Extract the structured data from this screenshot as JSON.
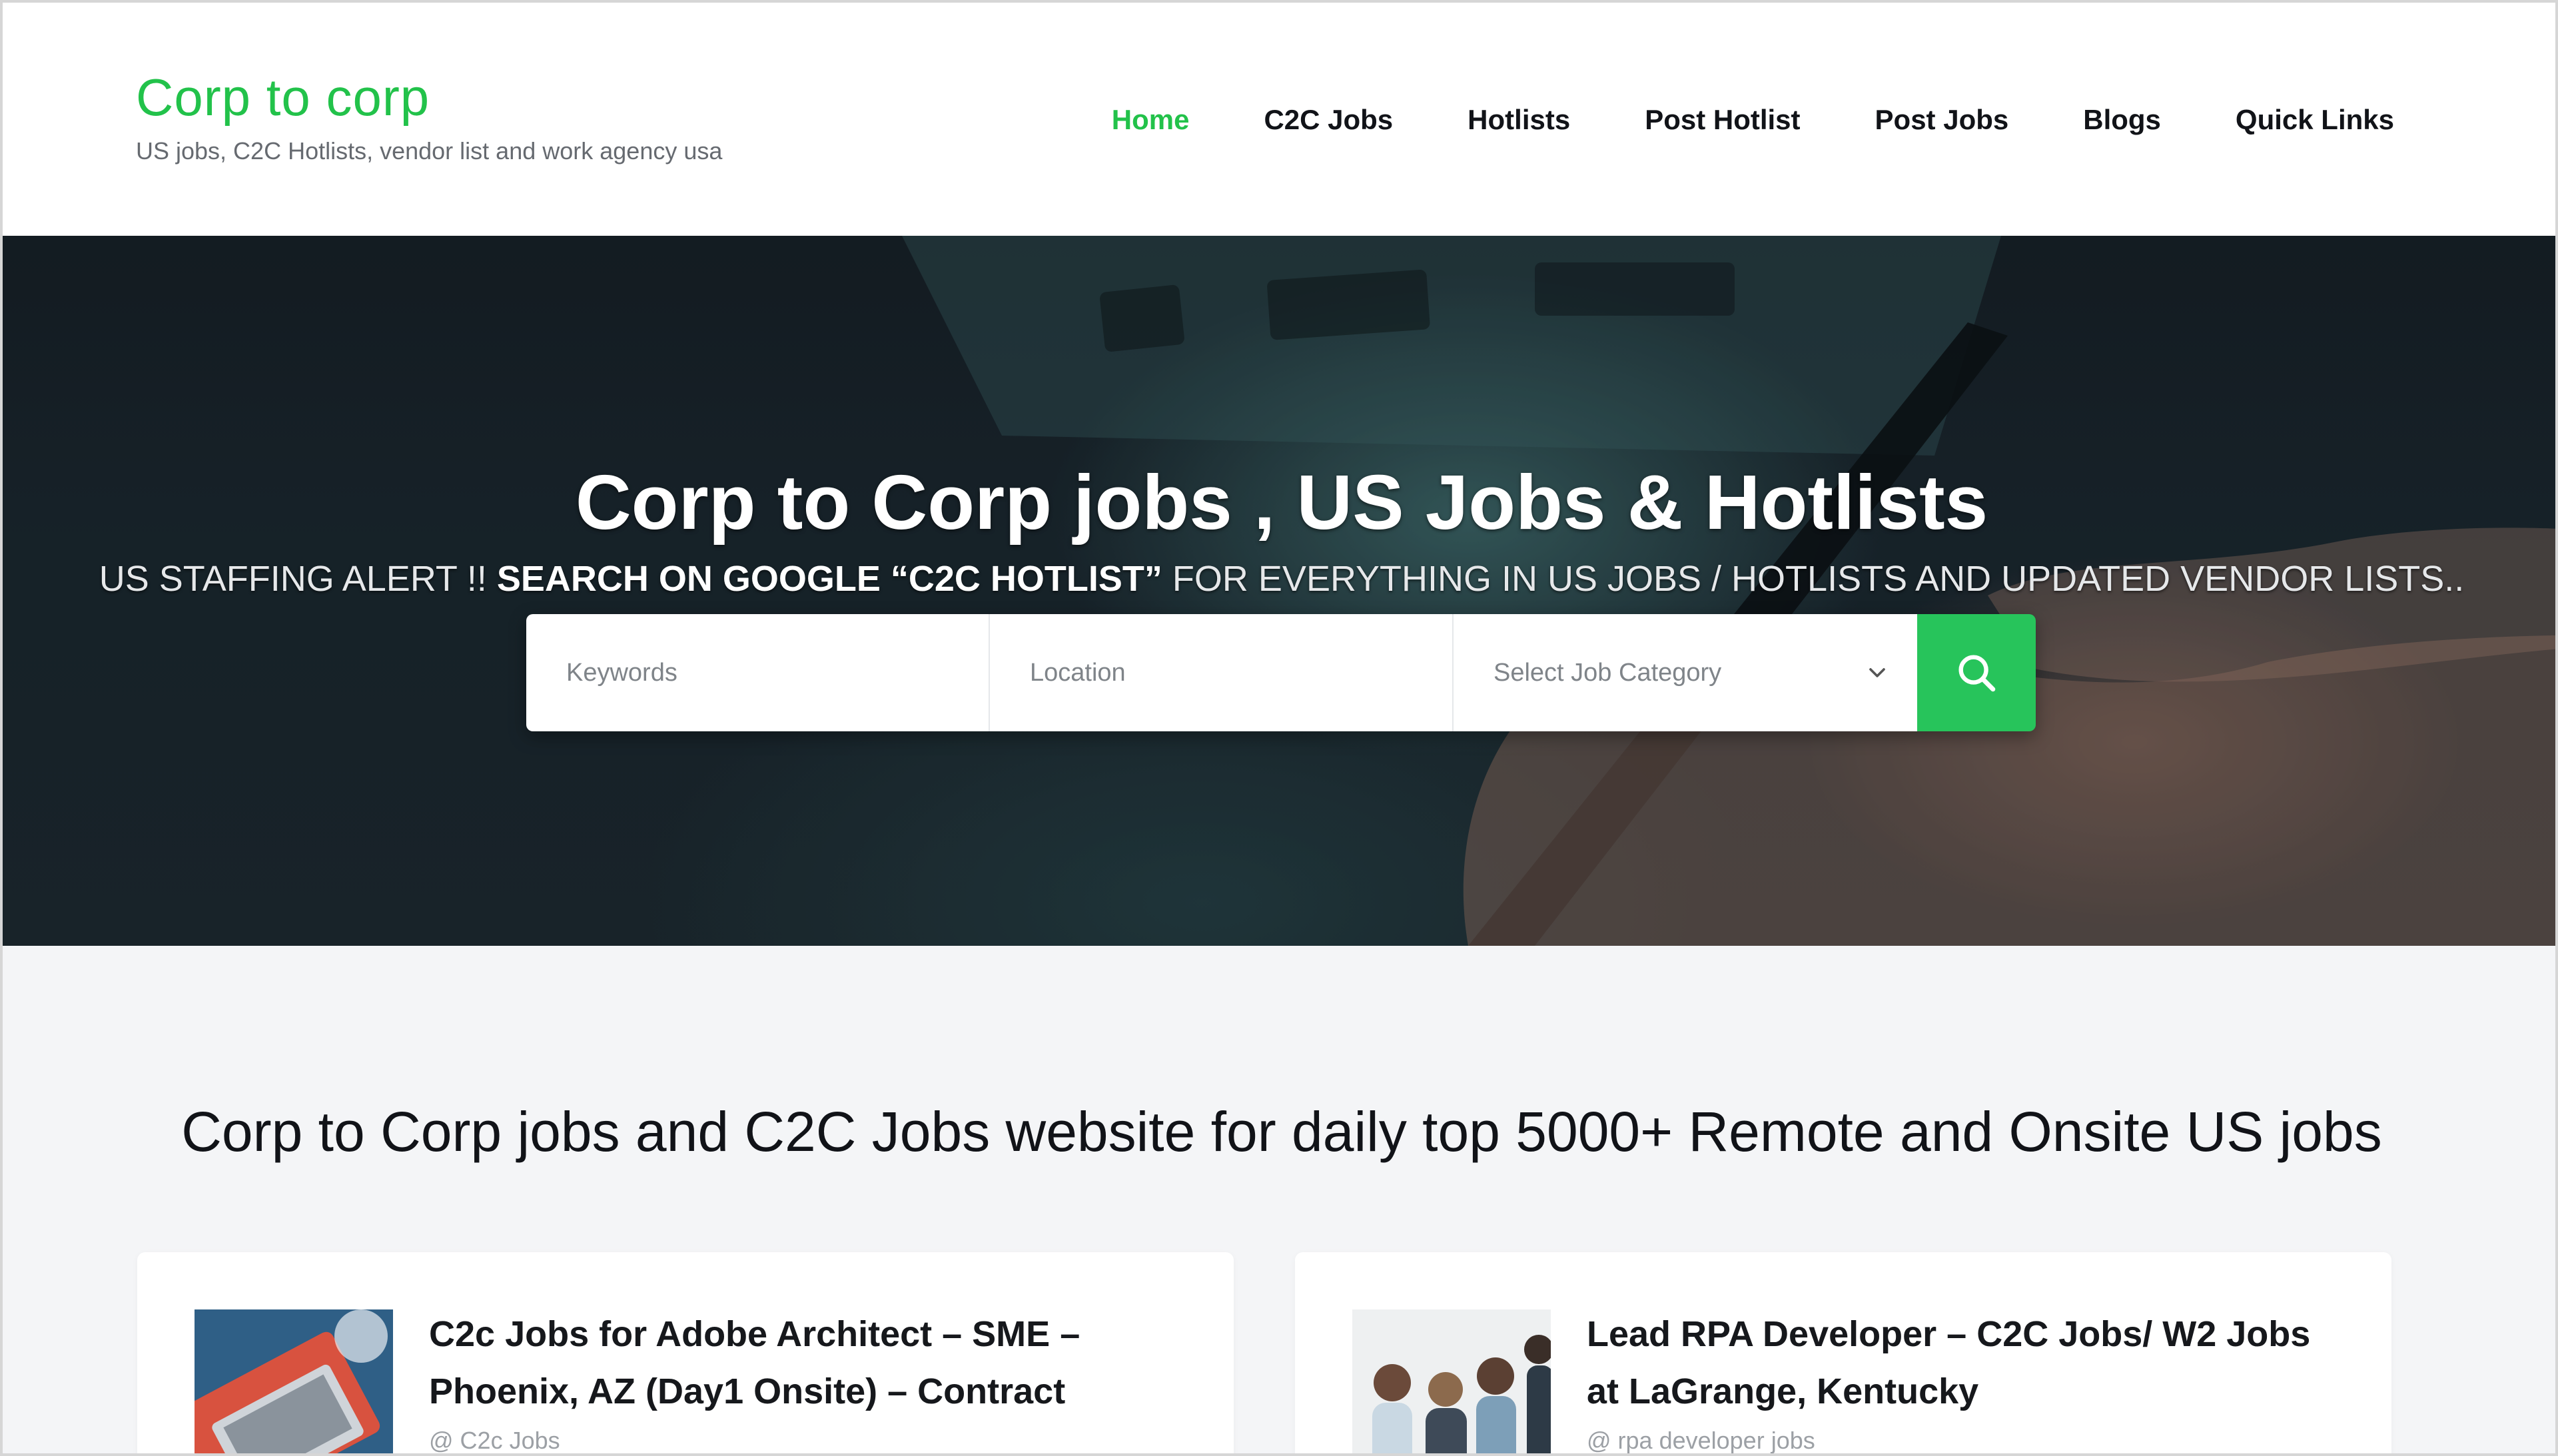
{
  "header": {
    "site_title": "Corp to corp",
    "tagline": "US jobs, C2C Hotlists, vendor list and work agency usa",
    "nav": [
      {
        "label": "Home",
        "active": true
      },
      {
        "label": "C2C Jobs"
      },
      {
        "label": "Hotlists"
      },
      {
        "label": "Post Hotlist"
      },
      {
        "label": "Post Jobs"
      },
      {
        "label": "Blogs"
      },
      {
        "label": "Quick Links"
      }
    ]
  },
  "hero": {
    "title": "Corp to Corp jobs , US Jobs & Hotlists",
    "alert_prefix": "US STAFFING ALERT !! ",
    "alert_bold": "SEARCH ON GOOGLE “C2C HOTLIST”",
    "alert_suffix": " FOR EVERYTHING IN US JOBS / HOTLISTS AND UPDATED VENDOR LISTS..",
    "search": {
      "keywords_placeholder": "Keywords",
      "location_placeholder": "Location",
      "category_value": "Select Job Category"
    }
  },
  "main": {
    "section_title": "Corp to Corp jobs and C2C Jobs website for daily top 5000+ Remote and Onsite US jobs",
    "cards": [
      {
        "title_line1": "C2c Jobs for Adobe Architect – SME –",
        "title_line2": "Phoenix, AZ (Day1 Onsite) – Contract",
        "meta": "@ C2c Jobs"
      },
      {
        "title_line1": "Lead RPA Developer – C2C Jobs/ W2 Jobs",
        "title_line2": "at LaGrange, Kentucky",
        "meta": "@ rpa developer jobs"
      }
    ]
  },
  "colors": {
    "brand_green": "#22c24a",
    "search_button": "#27c45b"
  },
  "icons": {
    "search": "search-icon",
    "dropdown": "chevron-down-icon"
  }
}
